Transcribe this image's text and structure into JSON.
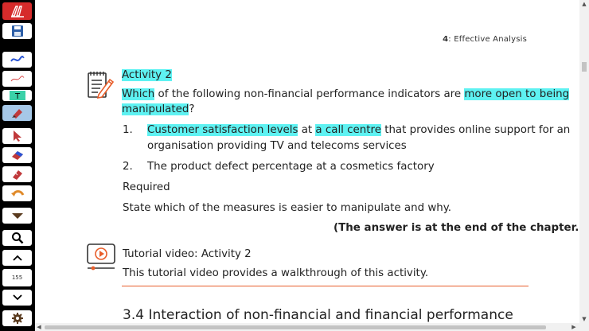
{
  "toolbar": {
    "page_number": "155"
  },
  "document": {
    "running_header_number": "4",
    "running_header_text": ": Effective Analysis",
    "activity": {
      "title": "Activity 2",
      "q_word1": "Which",
      "q_mid": " of the following non-financial performance indicators are ",
      "q_hl2": "more open to being",
      "q_hl3": "manipulated",
      "q_end": "?",
      "item1_num": "1.",
      "item1_hl1": "Customer satisfaction levels",
      "item1_mid": " at ",
      "item1_hl2": "a call centre",
      "item1_rest": " that provides online support for an",
      "item1_line2": "organisation providing TV and telecoms services",
      "item2_num": "2.",
      "item2_text": "The product defect percentage at a cosmetics factory",
      "required_label": "Required",
      "instruction": "State which of the measures is easier to manipulate and why.",
      "answer_note": "(The answer is at the end of the chapter.)"
    },
    "tutorial": {
      "title": "Tutorial video: Activity 2",
      "description": "This tutorial video provides a walkthrough of this activity."
    },
    "section_heading": "3.4 Interaction of non-financial and financial performance"
  },
  "colors": {
    "highlight": "#5ef2f2",
    "accent_rule": "#e85d2a",
    "logo_red": "#d62b2b",
    "active_tool": "#a6c8e8"
  }
}
